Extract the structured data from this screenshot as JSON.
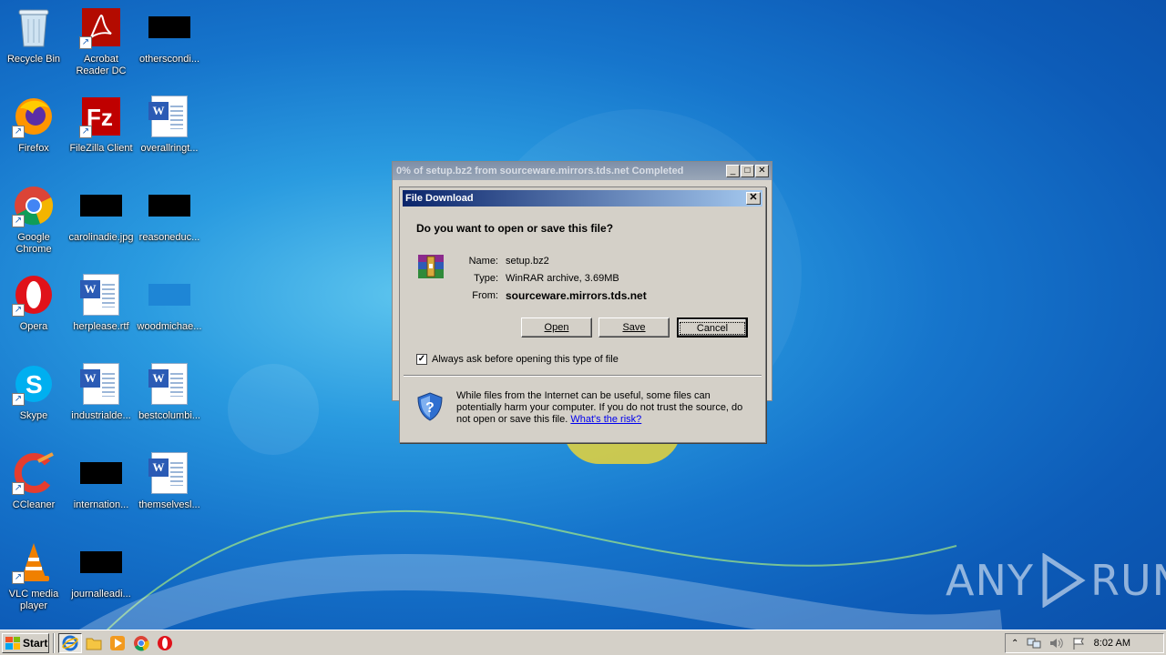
{
  "desktop": {
    "icons": [
      {
        "label": "Recycle Bin",
        "icon": "recycle-bin-icon"
      },
      {
        "label": "Acrobat Reader DC",
        "icon": "acrobat-icon"
      },
      {
        "label": "otherscondi...",
        "icon": "redacted-file-icon"
      },
      {
        "label": "Firefox",
        "icon": "firefox-icon"
      },
      {
        "label": "FileZilla Client",
        "icon": "filezilla-icon"
      },
      {
        "label": "overallringt...",
        "icon": "word-doc-icon"
      },
      {
        "label": "Google Chrome",
        "icon": "chrome-icon"
      },
      {
        "label": "carolinadie.jpg",
        "icon": "redacted-file-icon"
      },
      {
        "label": "reasoneduc...",
        "icon": "redacted-file-icon"
      },
      {
        "label": "Opera",
        "icon": "opera-icon"
      },
      {
        "label": "herplease.rtf",
        "icon": "word-doc-icon"
      },
      {
        "label": "woodmichae...",
        "icon": "blank-file-icon"
      },
      {
        "label": "Skype",
        "icon": "skype-icon"
      },
      {
        "label": "industrialde...",
        "icon": "word-doc-icon"
      },
      {
        "label": "bestcolumbi...",
        "icon": "word-doc-icon"
      },
      {
        "label": "CCleaner",
        "icon": "ccleaner-icon"
      },
      {
        "label": "internation...",
        "icon": "redacted-file-icon"
      },
      {
        "label": "themselvesl...",
        "icon": "word-doc-icon"
      },
      {
        "label": "VLC media player",
        "icon": "vlc-icon"
      },
      {
        "label": "journalleadi...",
        "icon": "redacted-file-icon"
      }
    ]
  },
  "background_window": {
    "title": "0% of setup.bz2 from sourceware.mirrors.tds.net Completed"
  },
  "dialog": {
    "title": "File Download",
    "question": "Do you want to open or save this file?",
    "name_label": "Name:",
    "name_value": "setup.bz2",
    "type_label": "Type:",
    "type_value": "WinRAR archive, 3.69MB",
    "from_label": "From:",
    "from_value": "sourceware.mirrors.tds.net",
    "open_label": "Open",
    "save_label": "Save",
    "cancel_label": "Cancel",
    "checkbox_label": "Always ask before opening this type of file",
    "checkbox_checked": true,
    "warning_text": "While files from the Internet can be useful, some files can potentially harm your computer. If you do not trust the source, do not open or save this file.",
    "risk_link": "What's the risk?"
  },
  "taskbar": {
    "start_label": "Start",
    "clock": "8:02 AM"
  },
  "watermark": {
    "left": "ANY",
    "right": "RUN"
  },
  "colors": {
    "dialog_title_start": "#0a246a",
    "dialog_title_end": "#a6caf0",
    "face": "#d4d0c8"
  }
}
